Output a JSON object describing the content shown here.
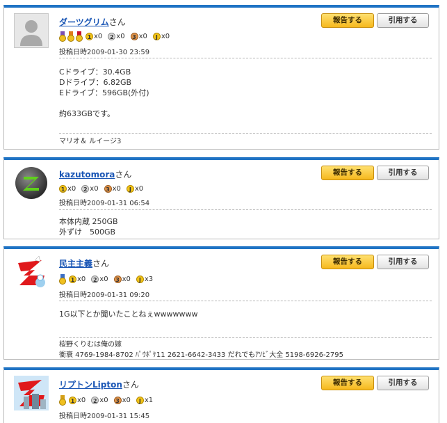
{
  "labels": {
    "report": "報告する",
    "quote": "引用する",
    "posted_prefix": "投稿日時",
    "san": "さん"
  },
  "posts": [
    {
      "username": "ダーツグリム",
      "medals": [
        "x0",
        "x0",
        "x0",
        "x0"
      ],
      "posted_at": "2009-01-30 23:59",
      "body": "Cドライブ：30.4GB\nDドライブ：6.82GB\nEドライブ：596GB(外付)\n\n約633GBです。",
      "signature": "マリオ＆ ルイージ3"
    },
    {
      "username": "kazutomora",
      "medals": [
        "x0",
        "x0",
        "x0",
        "x0"
      ],
      "posted_at": "2009-01-31 06:54",
      "body": "本体内蔵 250GB\n外ずけ　500GB"
    },
    {
      "username": "民主主義",
      "medals": [
        "x0",
        "x0",
        "x0",
        "x3"
      ],
      "posted_at": "2009-01-31 09:20",
      "body": "1G以下とか聞いたことねぇwwwwwww",
      "signature": "桜野くりむは俺の嫁\n衝衰 4769-1984-8702 ﾊﾟｳﾎﾟｹ11 2621-6642-3433 だれでもｱｿﾋﾞ大全 5198-6926-2795"
    },
    {
      "username": "リプトンLipton",
      "medals": [
        "x0",
        "x0",
        "x0",
        "x1"
      ],
      "posted_at": "2009-01-31 15:45"
    }
  ]
}
